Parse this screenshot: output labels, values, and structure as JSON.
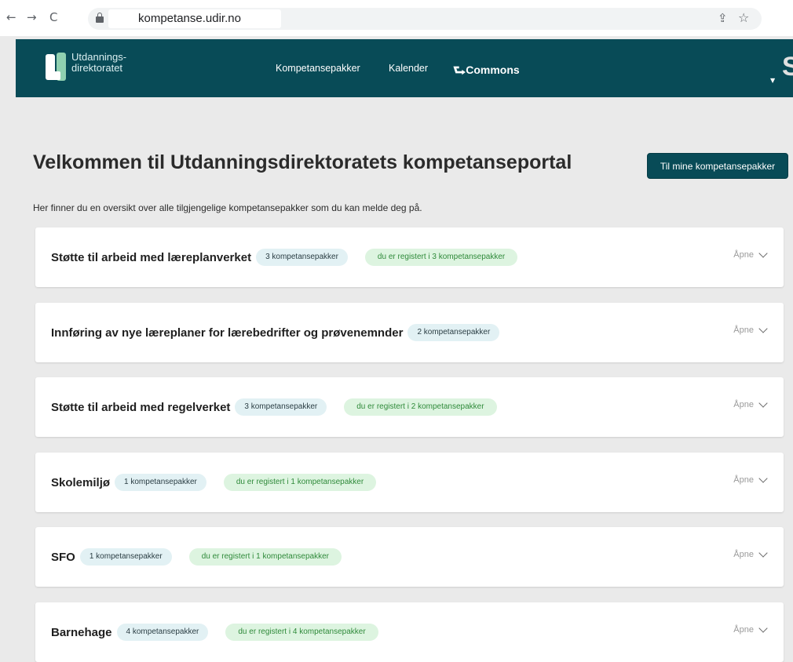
{
  "browser": {
    "url": "kompetanse.udir.no",
    "back_glyph": "←",
    "forward_glyph": "→",
    "reload_glyph": "C",
    "share_glyph": "⇪",
    "star_glyph": "☆"
  },
  "header": {
    "logo_line1": "Utdannings-",
    "logo_line2": "direktoratet",
    "nav": {
      "kompetansepakker": "Kompetansepakker",
      "kalender": "Kalender",
      "commons_icon": "⮑",
      "commons": "Commons"
    },
    "user_initial": "S",
    "user_caret": "▼"
  },
  "main": {
    "title": "Velkommen til Utdanningsdirektoratets kompetanseportal",
    "cta_button": "Til mine kompetansepakker",
    "intro": "Her finner du en oversikt over alle tilgjengelige kompetansepakker som du kan melde deg på.",
    "toggle_label": "Åpne",
    "categories": [
      {
        "title": "Støtte til arbeid med læreplanverket",
        "count": "3 kompetansepakker",
        "registered": "du er registert i 3 kompetansepakker"
      },
      {
        "title": "Innføring av nye læreplaner for lærebedrifter og prøvenemnder",
        "count": "2 kompetansepakker",
        "registered": ""
      },
      {
        "title": "Støtte til arbeid med regelverket",
        "count": "3 kompetansepakker",
        "registered": "du er registert i 2 kompetansepakker"
      },
      {
        "title": "Skolemiljø",
        "count": "1 kompetansepakker",
        "registered": "du er registert i 1 kompetansepakker"
      },
      {
        "title": "SFO",
        "count": "1 kompetansepakker",
        "registered": "du er registert i 1 kompetansepakker"
      },
      {
        "title": "Barnehage",
        "count": "4 kompetansepakker",
        "registered": "du er registert i 4 kompetansepakker"
      }
    ]
  },
  "colors": {
    "header_bg": "#084b57",
    "count_badge_bg": "#e2f1f4",
    "registered_badge_bg": "#ddf4e0",
    "registered_text": "#2f8a3a",
    "page_bg": "#eaeaea"
  }
}
